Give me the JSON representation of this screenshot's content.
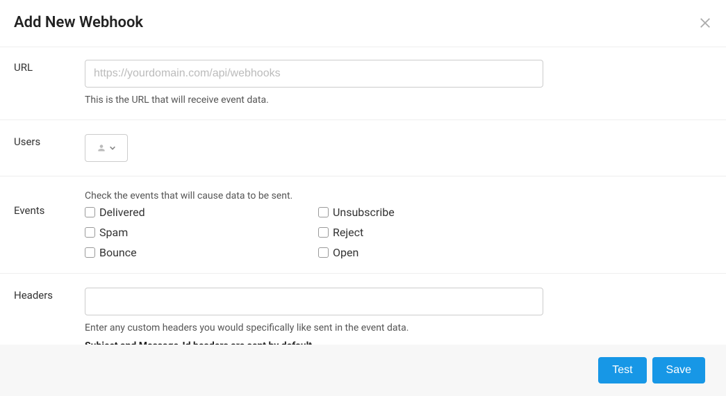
{
  "header": {
    "title": "Add New Webhook"
  },
  "url": {
    "label": "URL",
    "placeholder": "https://yourdomain.com/api/webhooks",
    "value": "",
    "help": "This is the URL that will receive event data."
  },
  "users": {
    "label": "Users"
  },
  "events": {
    "label": "Events",
    "instruction": "Check the events that will cause data to be sent.",
    "items": [
      {
        "label": "Delivered",
        "checked": false
      },
      {
        "label": "Unsubscribe",
        "checked": false
      },
      {
        "label": "Spam",
        "checked": false
      },
      {
        "label": "Reject",
        "checked": false
      },
      {
        "label": "Bounce",
        "checked": false
      },
      {
        "label": "Open",
        "checked": false
      }
    ]
  },
  "headers": {
    "label": "Headers",
    "value": "",
    "help": "Enter any custom headers you would specifically like sent in the event data.",
    "help_strong": "Subject and Message-Id headers are sent by default"
  },
  "footer": {
    "test_label": "Test",
    "save_label": "Save"
  }
}
